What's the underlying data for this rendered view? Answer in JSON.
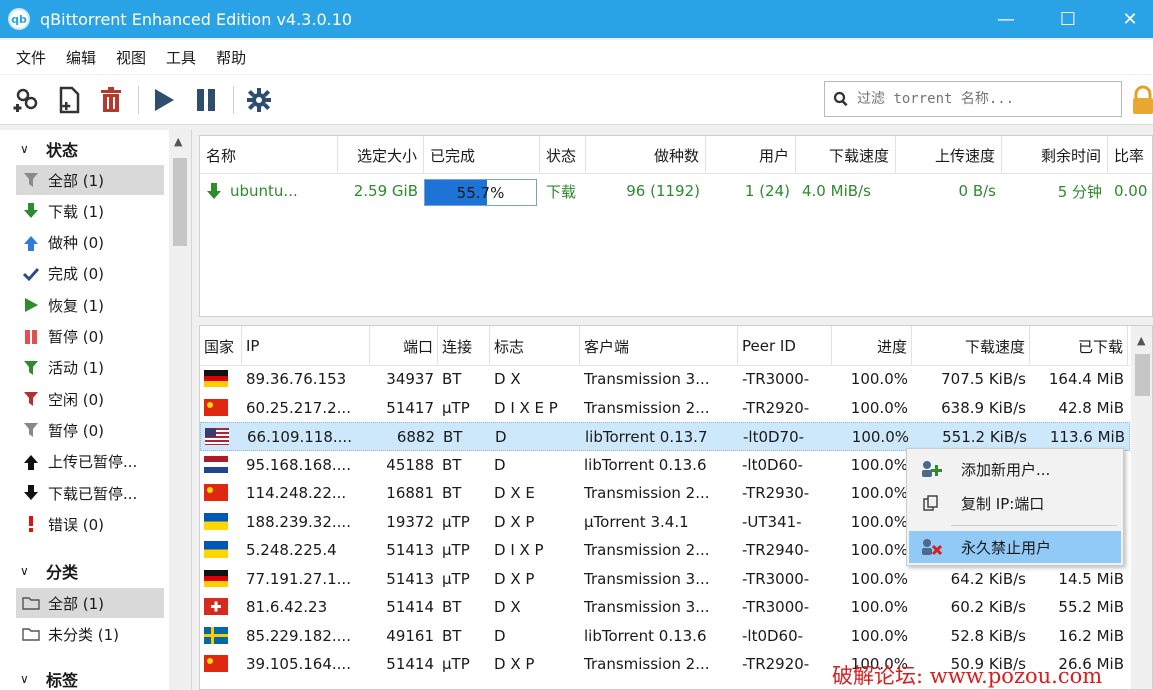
{
  "window": {
    "title": "qBittorrent Enhanced Edition v4.3.0.10",
    "app_icon": "qb"
  },
  "menu": [
    "文件",
    "编辑",
    "视图",
    "工具",
    "帮助"
  ],
  "toolbar": {
    "search_placeholder": "过滤 torrent 名称..."
  },
  "sidebar": {
    "status_header": "状态",
    "status_items": [
      {
        "icon": "filter-icon",
        "label": "全部 (1)",
        "color": "#8a8a8a"
      },
      {
        "icon": "arrow-down-icon",
        "label": "下载 (1)",
        "color": "#2e8b2e"
      },
      {
        "icon": "arrow-up-icon",
        "label": "做种 (0)",
        "color": "#2f7be0"
      },
      {
        "icon": "check-icon",
        "label": "完成 (0)",
        "color": "#2d4f80"
      },
      {
        "icon": "play-icon",
        "label": "恢复 (1)",
        "color": "#2e8b2e"
      },
      {
        "icon": "pause-icon",
        "label": "暂停 (0)",
        "color": "#e35050"
      },
      {
        "icon": "filter-icon",
        "label": "活动 (1)",
        "color": "#2e8b2e"
      },
      {
        "icon": "filter-icon",
        "label": "空闲 (0)",
        "color": "#b53030"
      },
      {
        "icon": "filter-icon",
        "label": "暂停 (0)",
        "color": "#888888"
      },
      {
        "icon": "arrow-up-icon",
        "label": "上传已暂停...",
        "color": "#111111"
      },
      {
        "icon": "arrow-down-icon",
        "label": "下载已暂停...",
        "color": "#111111"
      },
      {
        "icon": "exclamation-icon",
        "label": "错误 (0)",
        "color": "#e01010"
      }
    ],
    "category_header": "分类",
    "category_items": [
      {
        "icon": "folder-icon",
        "label": "全部 (1)"
      },
      {
        "icon": "folder-icon",
        "label": "未分类 (1)"
      }
    ],
    "tags_header": "标签"
  },
  "torrents": {
    "columns": [
      "名称",
      "选定大小",
      "已完成",
      "状态",
      "做种数",
      "用户",
      "下载速度",
      "上传速度",
      "剩余时间",
      "比率"
    ],
    "rows": [
      {
        "name": "ubuntu...",
        "size": "2.59 GiB",
        "progress": 0.557,
        "progress_text": "55.7%",
        "status": "下载",
        "seeds": "96 (1192)",
        "peers": "1 (24)",
        "dl": "4.0 MiB/s",
        "ul": "0 B/s",
        "eta": "5 分钟",
        "ratio": "0.00"
      }
    ]
  },
  "peers": {
    "columns": [
      "国家",
      "IP",
      "端口",
      "连接",
      "标志",
      "客户端",
      "Peer ID",
      "进度",
      "下载速度",
      "已下载"
    ],
    "rows": [
      {
        "flag": "de",
        "ip": "89.36.76.153",
        "port": "34937",
        "conn": "BT",
        "flags": "D X",
        "client": "Transmission 3...",
        "peer_id": "-TR3000-",
        "progress": "100.0%",
        "dl": "707.5 KiB/s",
        "downloaded": "164.4 MiB"
      },
      {
        "flag": "cn",
        "ip": "60.25.217.2...",
        "port": "51417",
        "conn": "μTP",
        "flags": "D I X E P",
        "client": "Transmission 2...",
        "peer_id": "-TR2920-",
        "progress": "100.0%",
        "dl": "638.9 KiB/s",
        "downloaded": "42.8 MiB"
      },
      {
        "flag": "us",
        "ip": "66.109.118....",
        "port": "6882",
        "conn": "BT",
        "flags": "D",
        "client": "libTorrent 0.13.7",
        "peer_id": "-lt0D70-",
        "progress": "100.0%",
        "dl": "551.2 KiB/s",
        "downloaded": "113.6 MiB"
      },
      {
        "flag": "nl",
        "ip": "95.168.168....",
        "port": "45188",
        "conn": "BT",
        "flags": "D",
        "client": "libTorrent 0.13.6",
        "peer_id": "-lt0D60-",
        "progress": "100.0%",
        "dl": "",
        "downloaded": ""
      },
      {
        "flag": "cn",
        "ip": "114.248.22...",
        "port": "16881",
        "conn": "BT",
        "flags": "D X E",
        "client": "Transmission 2...",
        "peer_id": "-TR2930-",
        "progress": "100.0%",
        "dl": "",
        "downloaded": ""
      },
      {
        "flag": "ua",
        "ip": "188.239.32....",
        "port": "19372",
        "conn": "μTP",
        "flags": "D X P",
        "client": "μTorrent 3.4.1",
        "peer_id": "-UT341-",
        "progress": "100.0%",
        "dl": "",
        "downloaded": ""
      },
      {
        "flag": "ua",
        "ip": "5.248.225.4",
        "port": "51413",
        "conn": "μTP",
        "flags": "D I X P",
        "client": "Transmission 2...",
        "peer_id": "-TR2940-",
        "progress": "100.0%",
        "dl": "",
        "downloaded": ""
      },
      {
        "flag": "de",
        "ip": "77.191.27.1...",
        "port": "51413",
        "conn": "μTP",
        "flags": "D X P",
        "client": "Transmission 3...",
        "peer_id": "-TR3000-",
        "progress": "100.0%",
        "dl": "64.2 KiB/s",
        "downloaded": "14.5 MiB"
      },
      {
        "flag": "ch",
        "ip": "81.6.42.23",
        "port": "51414",
        "conn": "BT",
        "flags": "D X",
        "client": "Transmission 3...",
        "peer_id": "-TR3000-",
        "progress": "100.0%",
        "dl": "60.2 KiB/s",
        "downloaded": "55.2 MiB"
      },
      {
        "flag": "se",
        "ip": "85.229.182....",
        "port": "49161",
        "conn": "BT",
        "flags": "D",
        "client": "libTorrent 0.13.6",
        "peer_id": "-lt0D60-",
        "progress": "100.0%",
        "dl": "52.8 KiB/s",
        "downloaded": "16.2 MiB"
      },
      {
        "flag": "cn",
        "ip": "39.105.164....",
        "port": "51414",
        "conn": "μTP",
        "flags": "D X P",
        "client": "Transmission 2...",
        "peer_id": "-TR2920-",
        "progress": "100.0%",
        "dl": "50.9 KiB/s",
        "downloaded": "26.6 MiB"
      }
    ]
  },
  "context_menu": {
    "items": [
      "添加新用户...",
      "复制 IP:端口",
      "永久禁止用户"
    ]
  },
  "watermark": "破解论坛: www.pozou.com",
  "colors": {
    "titlebar": "#2aa3e6",
    "accent": "#1d73d6",
    "download_green": "#2d8a2d",
    "selection": "#cde8fb",
    "menu_highlight": "#91c9f7"
  }
}
